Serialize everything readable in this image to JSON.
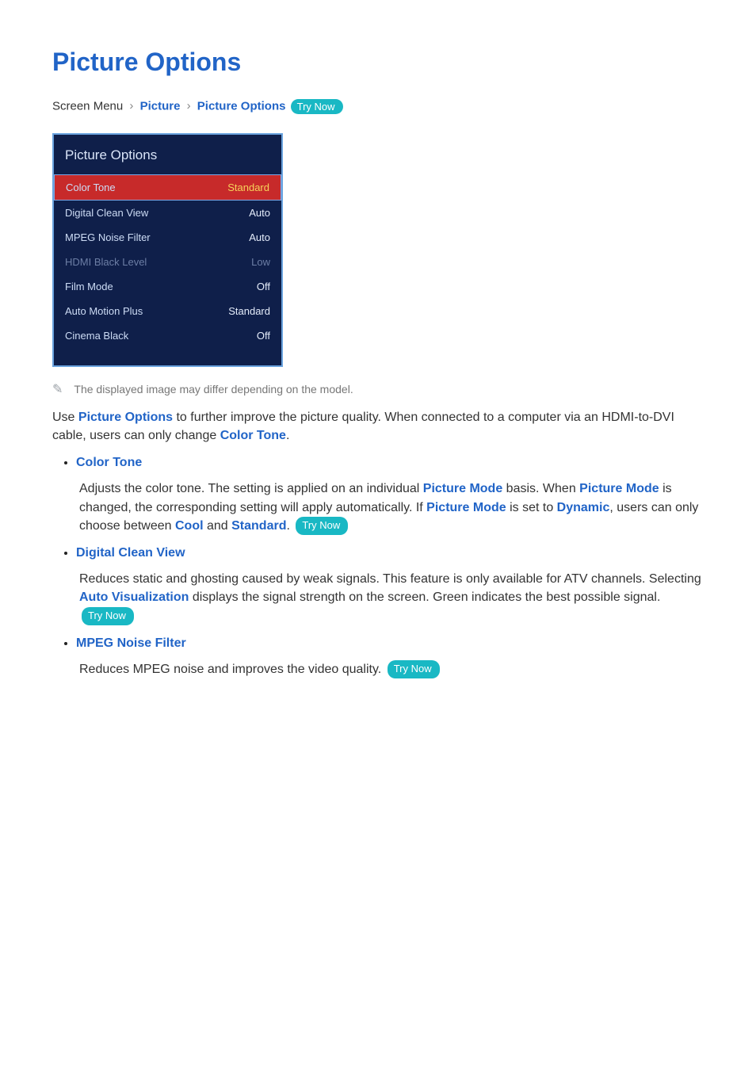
{
  "title": "Picture Options",
  "breadcrumb": {
    "pre": "Screen Menu",
    "seg1": "Picture",
    "seg2": "Picture Options",
    "try_now": "Try Now"
  },
  "panel": {
    "title": "Picture Options",
    "rows": [
      {
        "label": "Color Tone",
        "value": "Standard",
        "selected": true
      },
      {
        "label": "Digital Clean View",
        "value": "Auto"
      },
      {
        "label": "MPEG Noise Filter",
        "value": "Auto"
      },
      {
        "label": "HDMI Black Level",
        "value": "Low",
        "dim": true
      },
      {
        "label": "Film Mode",
        "value": "Off"
      },
      {
        "label": "Auto Motion Plus",
        "value": "Standard"
      },
      {
        "label": "Cinema Black",
        "value": "Off"
      }
    ]
  },
  "note": "The displayed image may differ depending on the model.",
  "intro": {
    "p1a": "Use ",
    "p1b": "Picture Options",
    "p1c": " to further improve the picture quality. When connected to a computer via an HDMI-to-DVI cable, users can only change ",
    "p1d": "Color Tone",
    "p1e": "."
  },
  "items": [
    {
      "title": "Color Tone",
      "runs": [
        {
          "t": "Adjusts the color tone. The setting is applied on an individual "
        },
        {
          "t": "Picture Mode",
          "hl": true
        },
        {
          "t": " basis. When "
        },
        {
          "t": "Picture Mode",
          "hl": true
        },
        {
          "t": " is changed, the corresponding setting will apply automatically. If "
        },
        {
          "t": "Picture Mode",
          "hl": true
        },
        {
          "t": " is set to "
        },
        {
          "t": "Dynamic",
          "hl": true
        },
        {
          "t": ", users can only choose between "
        },
        {
          "t": "Cool",
          "hl": true
        },
        {
          "t": " and "
        },
        {
          "t": "Standard",
          "hl": true
        },
        {
          "t": ". "
        }
      ],
      "try_now": "Try Now"
    },
    {
      "title": "Digital Clean View",
      "runs": [
        {
          "t": "Reduces static and ghosting caused by weak signals. This feature is only available for ATV channels. Selecting "
        },
        {
          "t": "Auto Visualization",
          "hl": true
        },
        {
          "t": " displays the signal strength on the screen. Green indicates the best possible signal. "
        }
      ],
      "try_now": "Try Now"
    },
    {
      "title": "MPEG Noise Filter",
      "runs": [
        {
          "t": "Reduces MPEG noise and improves the video quality. "
        }
      ],
      "try_now": "Try Now"
    }
  ]
}
